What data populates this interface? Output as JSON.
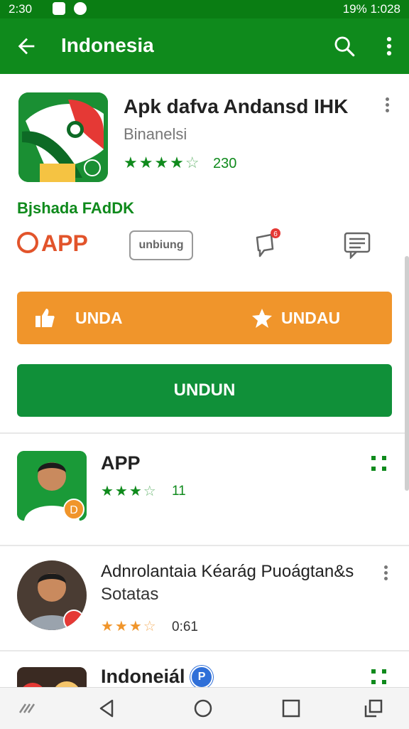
{
  "status_bar": {
    "time": "2:30",
    "status_time_right": "1:028",
    "battery": "19%"
  },
  "app_bar": {
    "title": "Indonesia",
    "back_icon": "arrow-left-icon",
    "search_icon": "search-icon",
    "more_icon": "more-vert-icon"
  },
  "featured_app": {
    "title": "Apk dafva Andansd IHK",
    "subtitle": "Binanelsi",
    "rating_value": "230",
    "stars_filled": 4,
    "stars_total": 5,
    "subline": "Bjshada FAdDK",
    "brand_label": "APP",
    "outline_button_label": "unbiung",
    "chat_badge": "6",
    "orange_left_label": "UNDA",
    "orange_right_label": "UNDAU",
    "green_button_label": "UNDUN"
  },
  "list": [
    {
      "title": "APP",
      "rating_value": "11",
      "stars_filled": 3,
      "stars_total": 4,
      "badge": "D"
    },
    {
      "title": "Adnrolantaia Kéarág Puoágtan&s",
      "subtitle": "Sotatas",
      "rating_value": "0:61",
      "stars_filled": 3,
      "stars_total": 4
    },
    {
      "title": "Indoneiál",
      "badge": "P"
    }
  ],
  "colors": {
    "primary": "#0f8a1c",
    "accent_orange": "#f0952b",
    "brand_red": "#e2542b"
  }
}
